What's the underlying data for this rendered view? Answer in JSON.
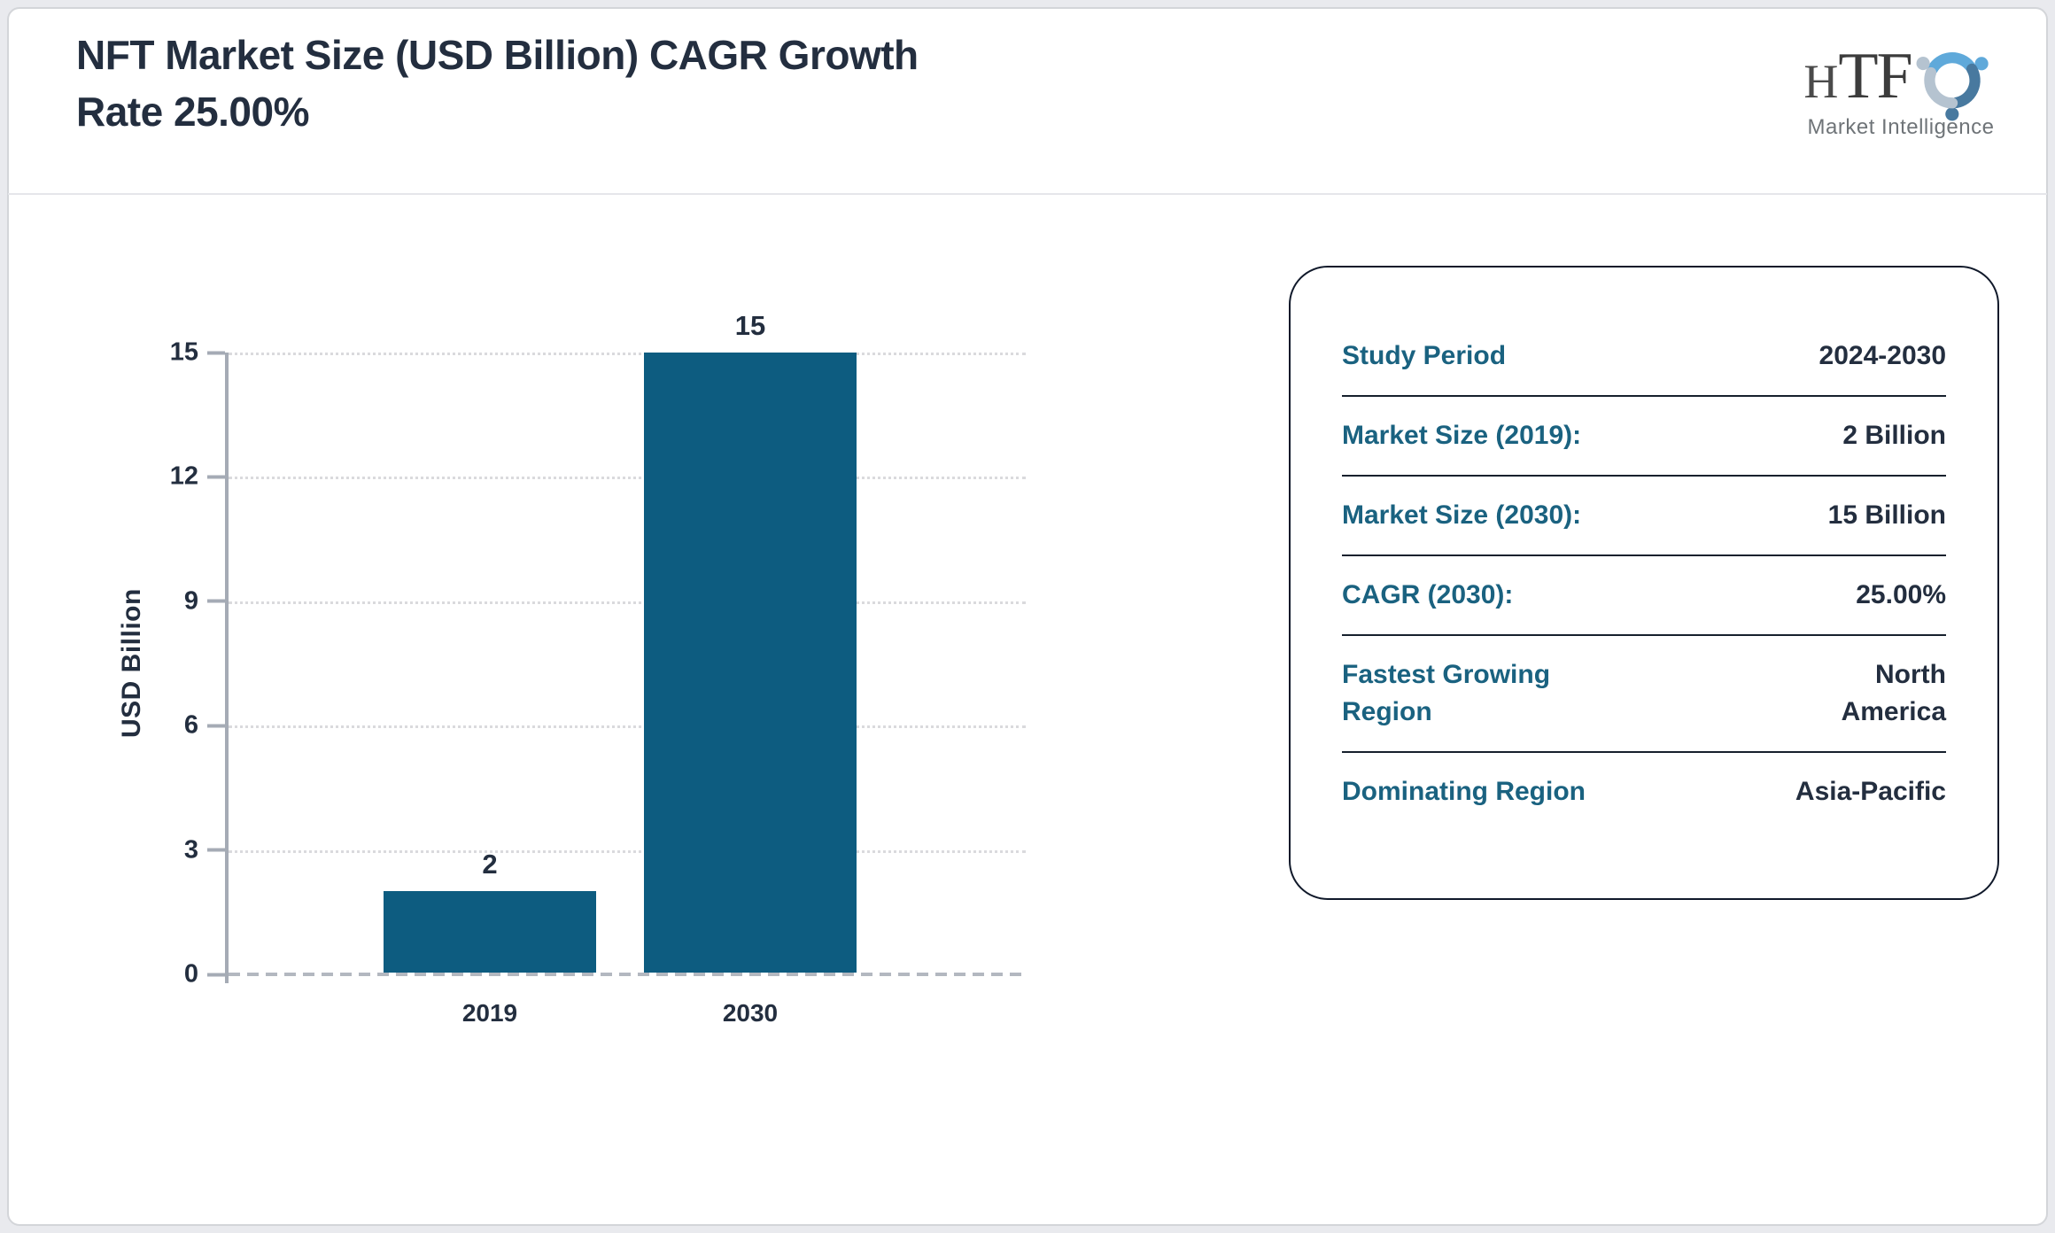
{
  "header": {
    "title_line1": "NFT Market Size (USD Billion) CAGR Growth",
    "title_line2": "Rate 25.00%"
  },
  "logo": {
    "brand_h": "H",
    "brand_tf": "TF",
    "tagline": "Market Intelligence"
  },
  "chart_data": {
    "type": "bar",
    "title": "NFT Market Size (USD Billion) CAGR Growth Rate 25.00%",
    "categories": [
      "2019",
      "2030"
    ],
    "values": [
      2,
      15
    ],
    "value_labels": [
      "2",
      "15"
    ],
    "xlabel": "",
    "ylabel": "USD Billion",
    "ylim": [
      0,
      15
    ],
    "yticks": [
      15,
      12,
      9,
      6,
      3,
      0
    ],
    "grid": "horizontal-dotted",
    "legend": "none",
    "bar_color": "#0d5c80"
  },
  "panel": {
    "rows": [
      {
        "label": "Study Period",
        "value": "2024-2030"
      },
      {
        "label": "Market Size (2019):",
        "value": "2 Billion"
      },
      {
        "label": "Market Size (2030):",
        "value": "15 Billion"
      },
      {
        "label": "CAGR (2030):",
        "value": "25.00%"
      },
      {
        "label": "Fastest Growing Region",
        "value": "North America"
      },
      {
        "label": "Dominating Region",
        "value": "Asia-Pacific"
      }
    ]
  },
  "colors": {
    "accent_teal": "#1a6280",
    "text_navy": "#232e3f",
    "bar_teal": "#0d5c80",
    "axis_gray": "#a5abb5"
  }
}
